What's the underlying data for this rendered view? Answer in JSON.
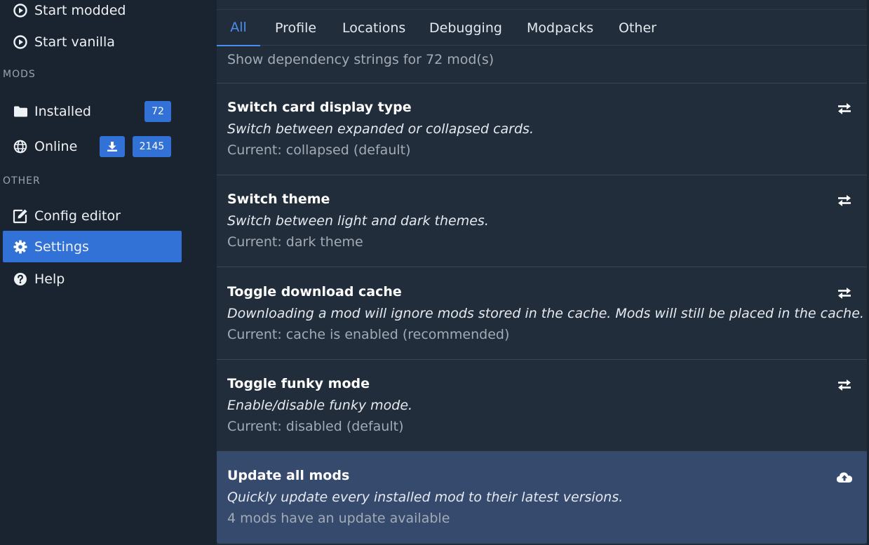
{
  "sidebar": {
    "start_modded": "Start modded",
    "start_vanilla": "Start vanilla",
    "section_mods": "MODS",
    "installed": {
      "label": "Installed",
      "count": "72"
    },
    "online": {
      "label": "Online",
      "count": "2145"
    },
    "section_other": "OTHER",
    "config_editor": "Config editor",
    "settings": "Settings",
    "help": "Help"
  },
  "tabs": [
    "All",
    "Profile",
    "Locations",
    "Debugging",
    "Modpacks",
    "Other"
  ],
  "active_tab": "All",
  "partial_card": {
    "current": "Show dependency strings for 72 mod(s)"
  },
  "cards": [
    {
      "title": "Switch card display type",
      "desc": "Switch between expanded or collapsed cards.",
      "current": "Current: collapsed (default)",
      "icon": "exchange-icon"
    },
    {
      "title": "Switch theme",
      "desc": "Switch between light and dark themes.",
      "current": "Current: dark theme",
      "icon": "exchange-icon"
    },
    {
      "title": "Toggle download cache",
      "desc": "Downloading a mod will ignore mods stored in the cache. Mods will still be placed in the cache.",
      "current": "Current: cache is enabled (recommended)",
      "icon": "exchange-icon"
    },
    {
      "title": "Toggle funky mode",
      "desc": "Enable/disable funky mode.",
      "current": "Current: disabled (default)",
      "icon": "exchange-icon"
    },
    {
      "title": "Update all mods",
      "desc": "Quickly update every installed mod to their latest versions.",
      "current": "4 mods have an update available",
      "icon": "cloud-upload-icon"
    }
  ],
  "colors": {
    "accent": "#3272d6",
    "tab_active": "#4b8ef0",
    "sidebar_bg": "#1a2330",
    "main_bg": "#212d3b",
    "highlight_card": "#364a6e"
  }
}
